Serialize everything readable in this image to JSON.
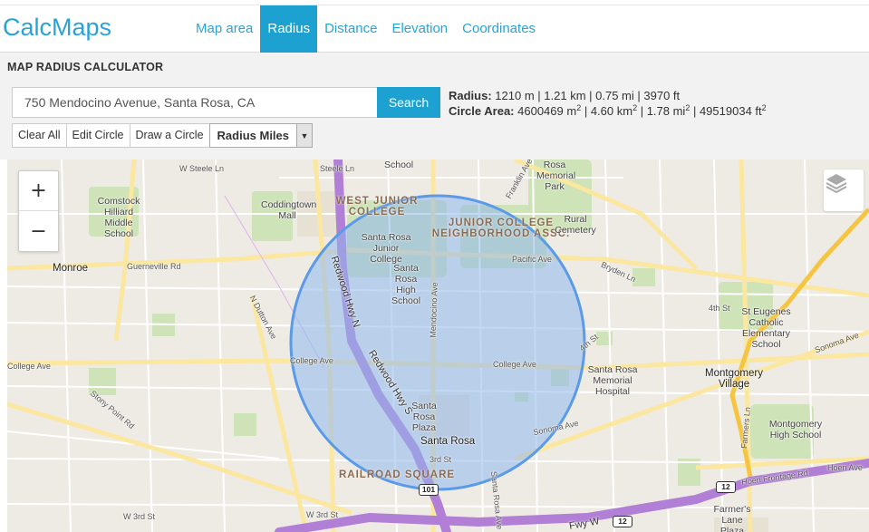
{
  "brand": {
    "name": "CalcMaps"
  },
  "nav": [
    {
      "label": "Map area",
      "active": false
    },
    {
      "label": "Radius",
      "active": true
    },
    {
      "label": "Distance",
      "active": false
    },
    {
      "label": "Elevation",
      "active": false
    },
    {
      "label": "Coordinates",
      "active": false
    }
  ],
  "page_title": "MAP RADIUS CALCULATOR",
  "search": {
    "value": "750 Mendocino Avenue, Santa Rosa, CA",
    "button": "Search"
  },
  "radius": {
    "label": "Radius:",
    "m": "1210 m",
    "km": "1.21 km",
    "mi": "0.75 mi",
    "ft": "3970 ft"
  },
  "area": {
    "label": "Circle Area:",
    "m2": "4600469 m",
    "km2": "4.60 km",
    "mi2": "1.78 mi",
    "ft2": "49519034 ft",
    "sup": "2"
  },
  "tools": {
    "clear": "Clear All",
    "edit": "Edit Circle",
    "draw": "Draw a Circle",
    "unit": "Radius Miles"
  },
  "map_controls": {
    "zoom_in": "+",
    "zoom_out": "−",
    "layers": "layers-icon"
  },
  "colors": {
    "accent": "#1da1d0",
    "circle_fill": "#8fb8ec",
    "circle_stroke": "#5b9ae8",
    "freeway": "#b27fd6"
  },
  "map_labels": {
    "districts": [
      "WEST JUNIOR COLLEGE",
      "JUNIOR COLLEGE NEIGHBORHOOD ASSC.",
      "RAILROAD SQUARE"
    ],
    "places": [
      "Comstock Hilliard Middle School",
      "Coddingtown Mall",
      "Santa Rosa Junior College",
      "Santa Rosa High School",
      "Rosa Memorial Park",
      "Rural Cemetery",
      "St Eugenes Catholic Elementary School",
      "Santa Rosa Memorial Hospital",
      "Montgomery Village",
      "Montgomery High School",
      "Santa Rosa Plaza",
      "Farmer's Lane Plaza",
      "Monroe",
      "Santa Rosa"
    ],
    "streets": [
      "W Steele Ln",
      "Steele Ln",
      "School",
      "Guerneville Rd",
      "Redwood Hwy N",
      "Redwood Hwy S",
      "N Dutton Ave",
      "College Ave",
      "Mendocino Ave",
      "Pacific Ave",
      "Bryden Ln",
      "4th St",
      "Sonoma Ave",
      "Stony Point Rd",
      "W 3rd St",
      "3rd St",
      "Santa Rosa Ave",
      "Franklin Ave",
      "Farmers Ln",
      "Hoen Frontage Rd",
      "Hoen Ave",
      "Fwy W"
    ],
    "shields": [
      "101",
      "12",
      "12"
    ]
  }
}
